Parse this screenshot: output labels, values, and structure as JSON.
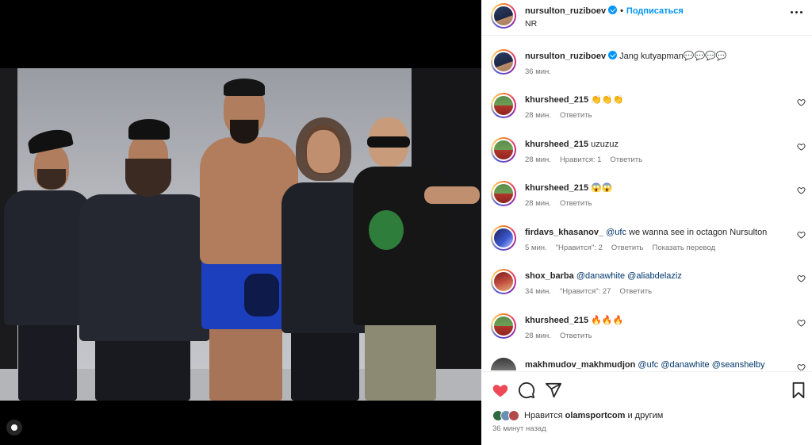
{
  "post_author": {
    "username": "nursulton_ruziboev",
    "follow_label": "Подписаться",
    "location": "NR"
  },
  "caption": {
    "username": "nursulton_ruziboev",
    "text": "Jang kutyapman💬💬💬💬",
    "time": "36 мин."
  },
  "comments": [
    {
      "username": "khursheed_215",
      "text": "👏👏👏",
      "time": "28 мин.",
      "likes": "",
      "reply": "Ответить",
      "extra": ""
    },
    {
      "username": "khursheed_215",
      "text": "uzuzuz",
      "time": "28 мин.",
      "likes": "Нравится: 1",
      "reply": "Ответить",
      "extra": ""
    },
    {
      "username": "khursheed_215",
      "text": "😱😱",
      "time": "28 мин.",
      "likes": "",
      "reply": "Ответить",
      "extra": ""
    },
    {
      "username": "firdavs_khasanov_",
      "mention": "@ufc",
      "text": " we wanna see in octagon Nursulton",
      "time": "5 мин.",
      "likes": "\"Нравится\": 2",
      "reply": "Ответить",
      "extra": "Показать перевод"
    },
    {
      "username": "shox_barba",
      "mention": "@danawhite @aliabdelaziz",
      "text": "",
      "time": "34 мин.",
      "likes": "\"Нравится\": 27",
      "reply": "Ответить",
      "extra": ""
    },
    {
      "username": "khursheed_215",
      "text": "🔥🔥🔥",
      "time": "28 мин.",
      "likes": "",
      "reply": "Ответить",
      "extra": ""
    },
    {
      "username": "makhmudov_makhmudjon",
      "mention": "@ufc @danawhite @seanshelby",
      "text": "",
      "time": "",
      "likes": "",
      "reply": "",
      "extra": ""
    }
  ],
  "likes": {
    "prefix": "Нравится",
    "user": "olamsportcom",
    "suffix": "и другим"
  },
  "time_ago": "36 минут назад",
  "colors": {
    "accent": "#0095f6",
    "like_red": "#ed4956",
    "text": "#262626",
    "secondary": "#737373",
    "mention": "#00376b"
  },
  "icons": [
    "verified-badge-icon",
    "more-options-icon",
    "heart-icon",
    "comment-icon",
    "share-icon",
    "bookmark-icon",
    "user-tag-icon"
  ]
}
